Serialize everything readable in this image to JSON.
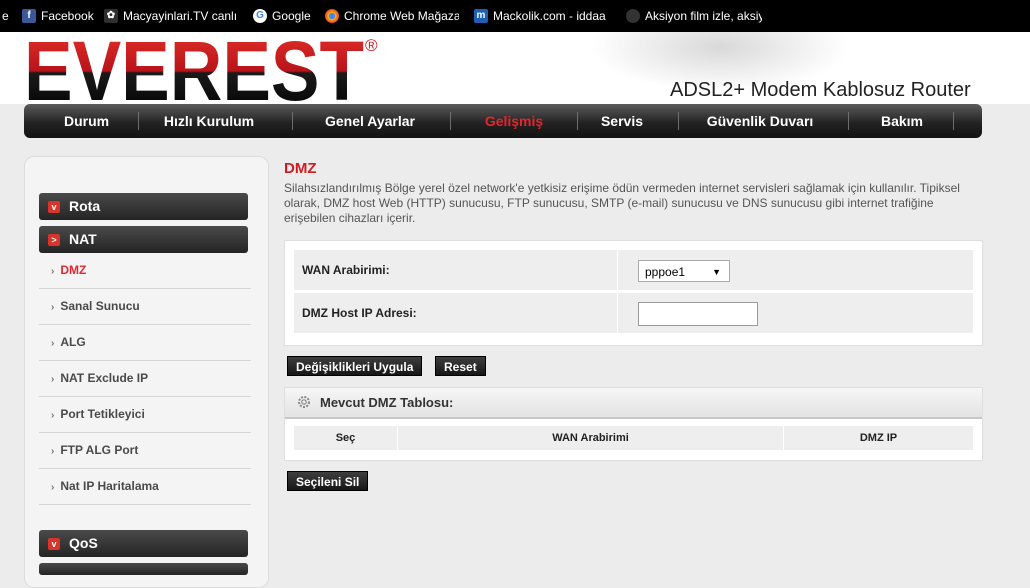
{
  "bookmarks": {
    "partial_left": "e",
    "items": [
      {
        "label": "Facebook",
        "icon": "facebook-icon",
        "color": "#3b5998"
      },
      {
        "label": "Macyayinlari.TV canlı",
        "icon": "macyayinlari-icon",
        "color": "#444444"
      },
      {
        "label": "Google",
        "icon": "google-icon",
        "color": "#ffffff"
      },
      {
        "label": "Chrome Web Mağaza",
        "icon": "chrome-web-store-icon",
        "color": "#e8710a"
      },
      {
        "label": "Mackolik.com - iddaa",
        "icon": "mackolik-icon",
        "color": "#1c5fb5"
      },
      {
        "label": "Aksiyon film izle, aksiy",
        "icon": "aksiyon-film-icon",
        "color": "#333333"
      }
    ]
  },
  "header": {
    "logo": "EVEREST",
    "registered": "®",
    "subtitle": "ADSL2+ Modem Kablosuz Router"
  },
  "nav": {
    "items": [
      {
        "label": "Durum"
      },
      {
        "label": "Hızlı Kurulum"
      },
      {
        "label": "Genel Ayarlar"
      },
      {
        "label": "Gelişmiş",
        "active": true
      },
      {
        "label": "Servis"
      },
      {
        "label": "Güvenlik Duvarı"
      },
      {
        "label": "Bakım"
      }
    ]
  },
  "sidebar": {
    "groups": [
      {
        "label": "Rota",
        "marker": "v"
      },
      {
        "label": "NAT",
        "marker": ">"
      },
      {
        "label": "QoS",
        "marker": "v"
      }
    ],
    "nat_items": [
      {
        "label": "DMZ",
        "active": true
      },
      {
        "label": "Sanal Sunucu"
      },
      {
        "label": "ALG"
      },
      {
        "label": "NAT Exclude IP"
      },
      {
        "label": "Port Tetikleyici"
      },
      {
        "label": "FTP ALG Port"
      },
      {
        "label": "Nat IP Haritalama"
      }
    ]
  },
  "main": {
    "title": "DMZ",
    "description": "Silahsızlandırılmış Bölge yerel özel network'e yetkisiz erişime ödün vermeden internet servisleri sağlamak için kullanılır. Tipiksel olarak, DMZ host Web (HTTP) sunucusu, FTP sunucusu, SMTP (e-mail) sunucusu ve DNS sunucusu gibi internet trafiğine erişebilen cihazları içerir.",
    "form": {
      "wan_label": "WAN Arabirimi:",
      "wan_value": "pppoe1",
      "dmz_host_label": "DMZ Host IP Adresi:",
      "dmz_host_value": ""
    },
    "apply_label": "Değişiklikleri Uygula",
    "reset_label": "Reset",
    "table": {
      "title": "Mevcut DMZ Tablosu:",
      "columns": [
        "Seç",
        "WAN Arabirimi",
        "DMZ IP"
      ]
    },
    "delete_label": "Seçileni Sil"
  },
  "colors": {
    "accent_red": "#e3262f",
    "nav_dark": "#1e1e1e",
    "page_bg": "#ececec"
  }
}
